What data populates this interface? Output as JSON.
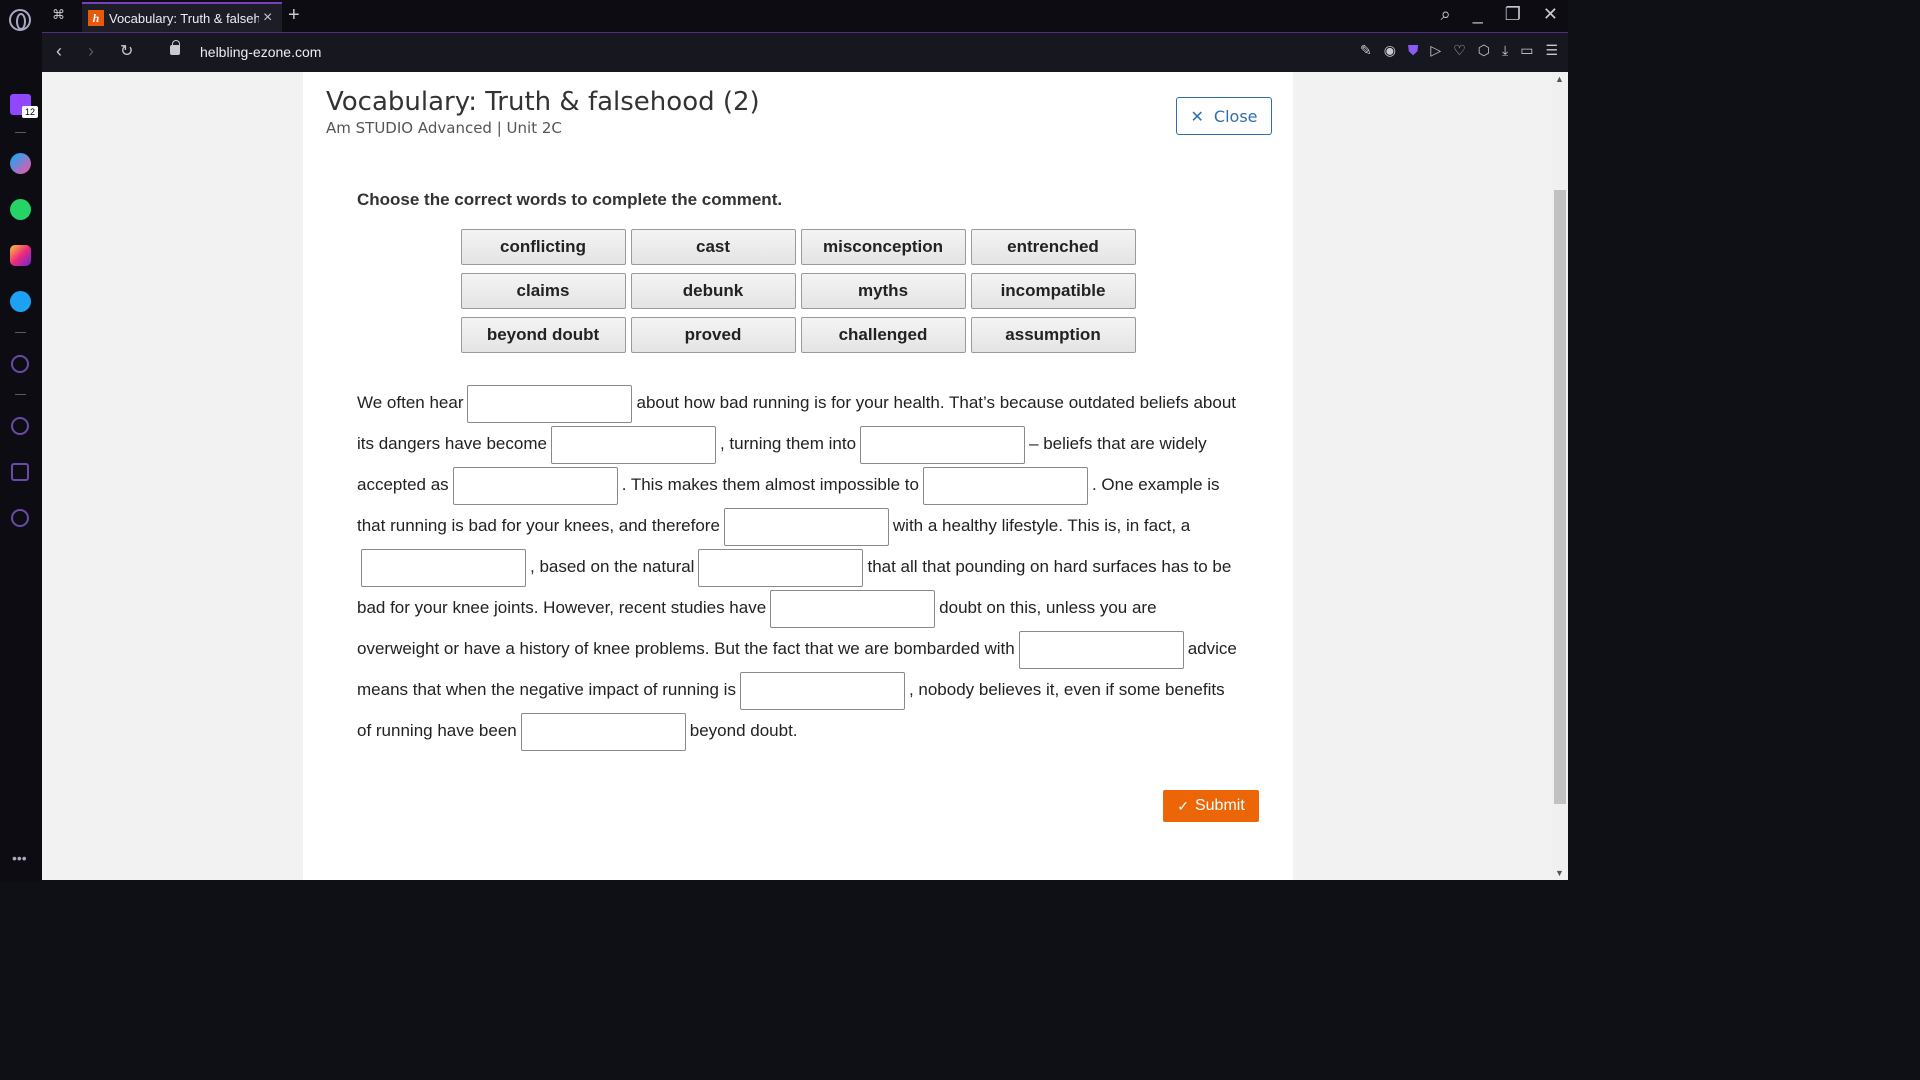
{
  "browser": {
    "tab_title": "Vocabulary: Truth & falsehood (2)",
    "favicon_letter": "h",
    "url": "helbling-ezone.com",
    "sidebar_badge": "12"
  },
  "header": {
    "title": "Vocabulary: Truth & falsehood (2)",
    "subtitle": "Am STUDIO Advanced | Unit 2C",
    "close_label": "Close"
  },
  "exercise": {
    "instruction": "Choose the correct words to complete the comment.",
    "word_bank": [
      "conflicting",
      "cast",
      "misconception",
      "entrenched",
      "claims",
      "debunk",
      "myths",
      "incompatible",
      "beyond doubt",
      "proved",
      "challenged",
      "assumption"
    ],
    "segments": [
      "We often hear",
      "about how bad running is for your health. That’s because outdated beliefs about its dangers have become",
      ", turning them into",
      "– beliefs that are widely accepted as",
      ". This makes them almost impossible to",
      ". One example is that running is bad for your knees, and therefore",
      "with a healthy lifestyle. This is, in fact, a",
      ", based on the natural",
      "that all that pounding on hard surfaces has to be bad for your knee joints. However, recent studies have",
      "doubt on this, unless you are overweight or have a history of knee problems. But the fact that we are bombarded with",
      "advice means that when the negative impact of running is",
      ", nobody believes it, even if some benefits of running have been",
      "beyond doubt."
    ],
    "submit_label": "Submit"
  },
  "colors": {
    "accent": "#2f6fad",
    "submit": "#ec6608",
    "browser_accent": "#7a3fc0"
  }
}
